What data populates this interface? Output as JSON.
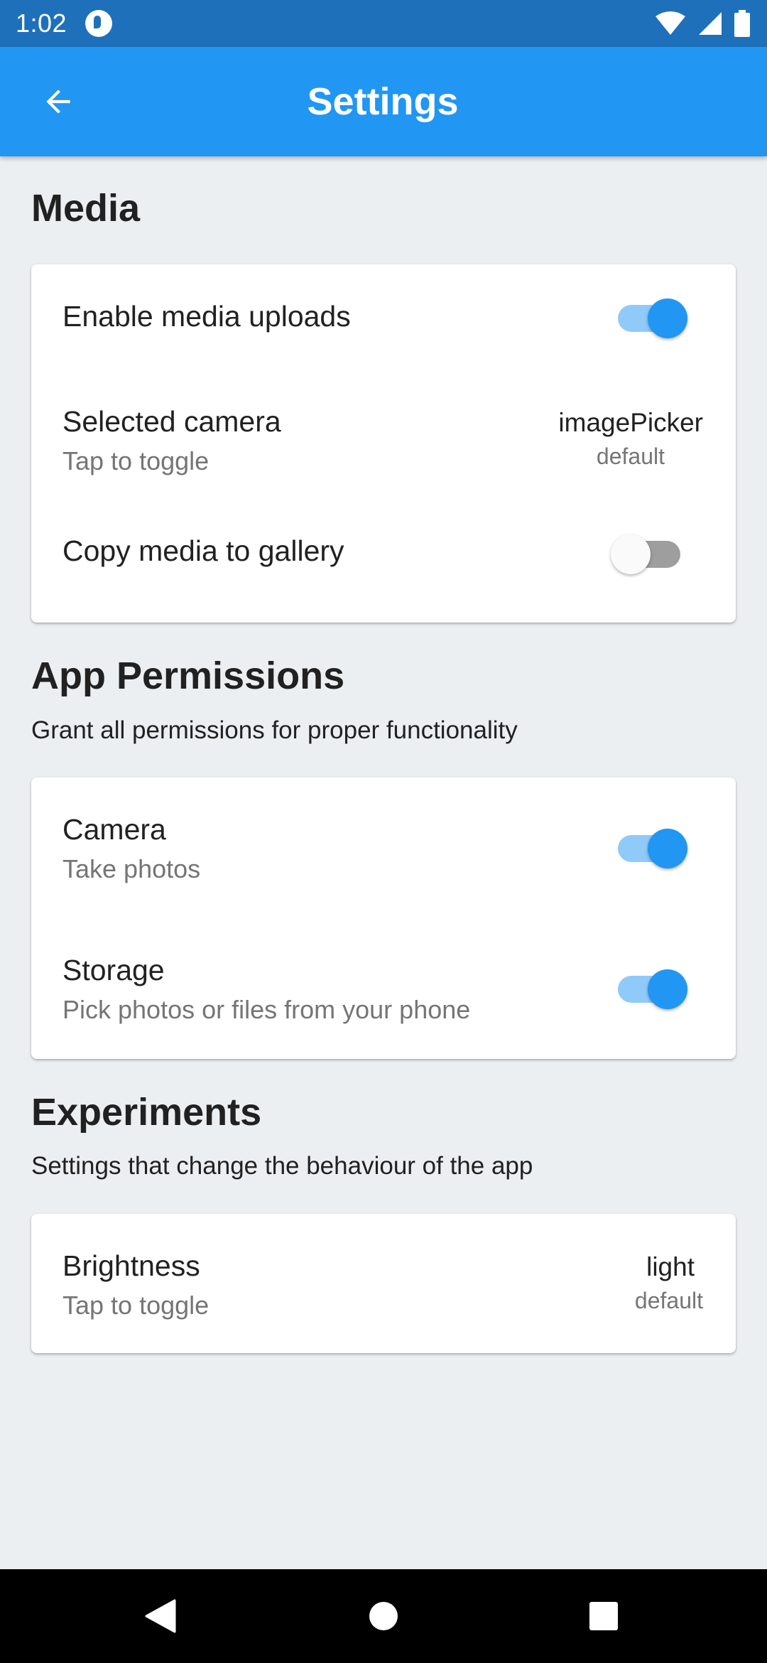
{
  "status_bar": {
    "time": "1:02",
    "icons": [
      "app-notification-icon",
      "wifi-icon",
      "cell-signal-icon",
      "battery-icon"
    ]
  },
  "app_bar": {
    "title": "Settings",
    "back_icon": "arrow-back-icon"
  },
  "colors": {
    "status_bar": "#1e70ba",
    "app_bar": "#2196f3",
    "accent": "#2196f3",
    "accent_track": "#90caf9",
    "background": "#eceff1"
  },
  "sections": {
    "media": {
      "title": "Media",
      "items": {
        "enable_uploads": {
          "title": "Enable media uploads",
          "enabled": true
        },
        "selected_camera": {
          "title": "Selected camera",
          "subtitle": "Tap to toggle",
          "value": "imagePicker",
          "value_sub": "default"
        },
        "copy_to_gallery": {
          "title": "Copy media to gallery",
          "enabled": false
        }
      }
    },
    "permissions": {
      "title": "App Permissions",
      "description": "Grant all permissions for proper functionality",
      "items": {
        "camera": {
          "title": "Camera",
          "subtitle": "Take photos",
          "enabled": true
        },
        "storage": {
          "title": "Storage",
          "subtitle": "Pick photos or files from your phone",
          "enabled": true
        }
      }
    },
    "experiments": {
      "title": "Experiments",
      "description": "Settings that change the behaviour of the app",
      "items": {
        "brightness": {
          "title": "Brightness",
          "subtitle": "Tap to toggle",
          "value": "light",
          "value_sub": "default"
        }
      }
    }
  },
  "nav_bar": {
    "icons": [
      "back-triangle-icon",
      "home-circle-icon",
      "recents-square-icon"
    ]
  }
}
